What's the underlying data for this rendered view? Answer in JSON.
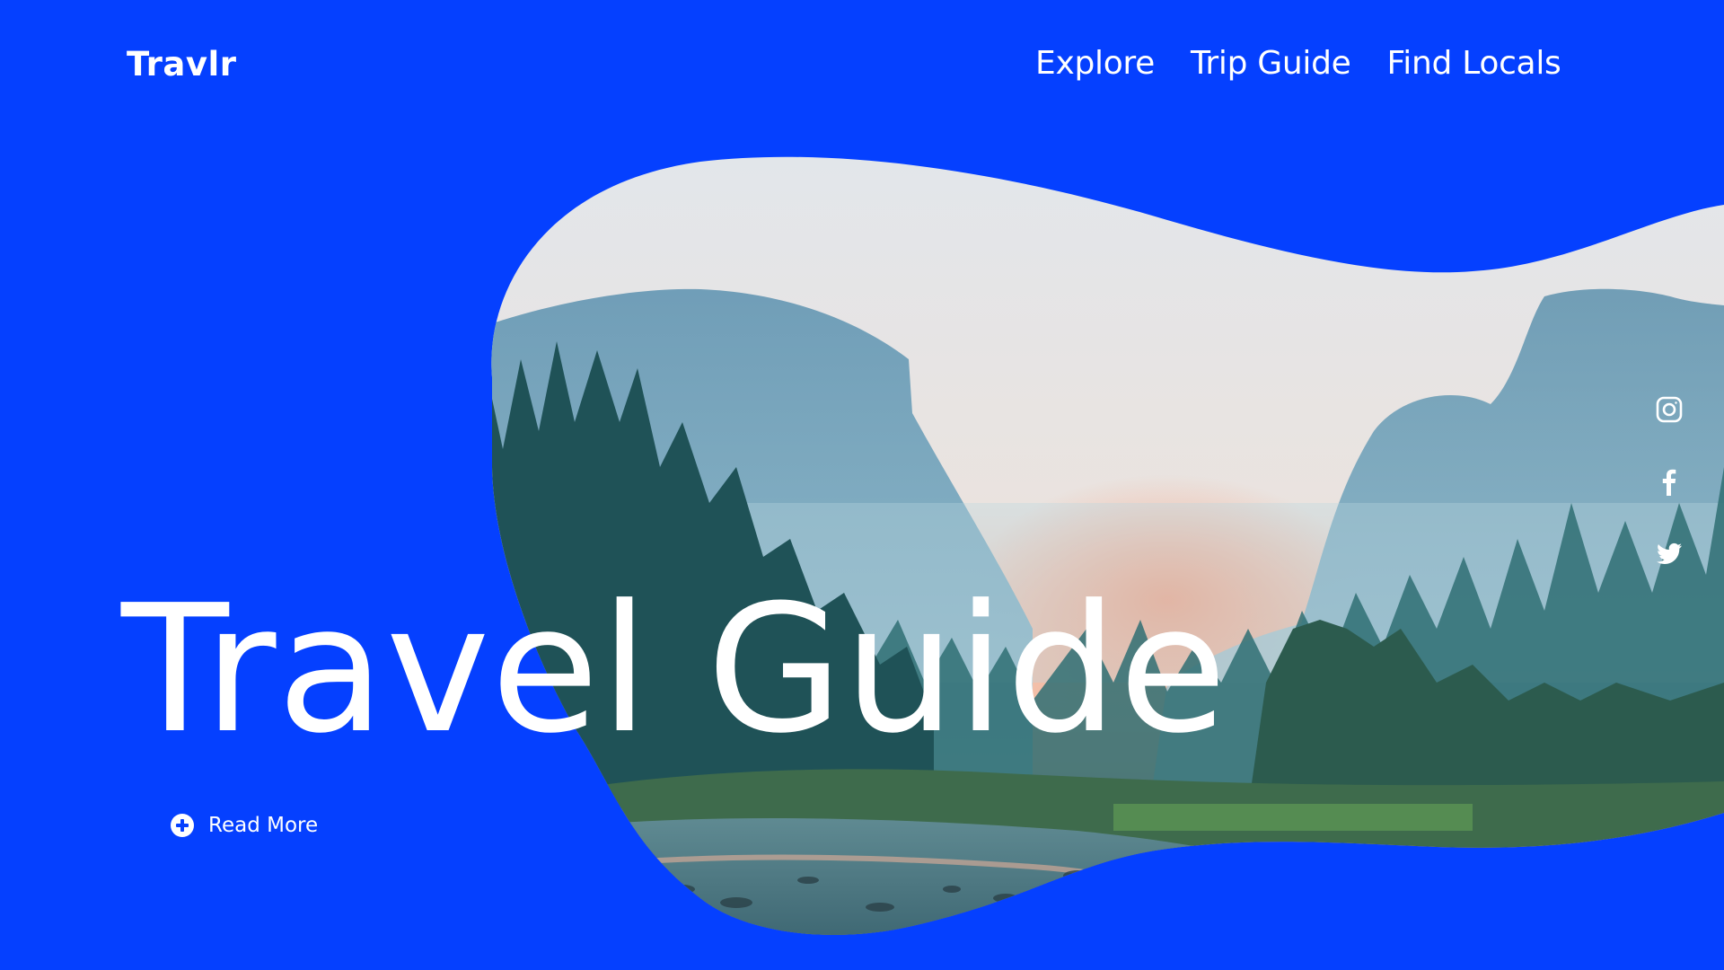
{
  "brand": {
    "logo": "Travlr"
  },
  "nav": {
    "items": [
      {
        "label": "Explore"
      },
      {
        "label": "Trip Guide"
      },
      {
        "label": "Find Locals"
      }
    ]
  },
  "hero": {
    "title": "Travel Guide",
    "cta_label": "Read More",
    "cta_icon": "plus-circle-icon",
    "image": "mountain-valley-forest-river-landscape"
  },
  "social": {
    "icons": [
      "instagram-icon",
      "facebook-icon",
      "twitter-icon"
    ]
  },
  "colors": {
    "background": "#0540ff",
    "text": "#ffffff",
    "sky_top": "#e4e8ec",
    "sunset": "#f0a88a",
    "mountains": "#6fa3bf",
    "forest": "#1f5a5c"
  }
}
